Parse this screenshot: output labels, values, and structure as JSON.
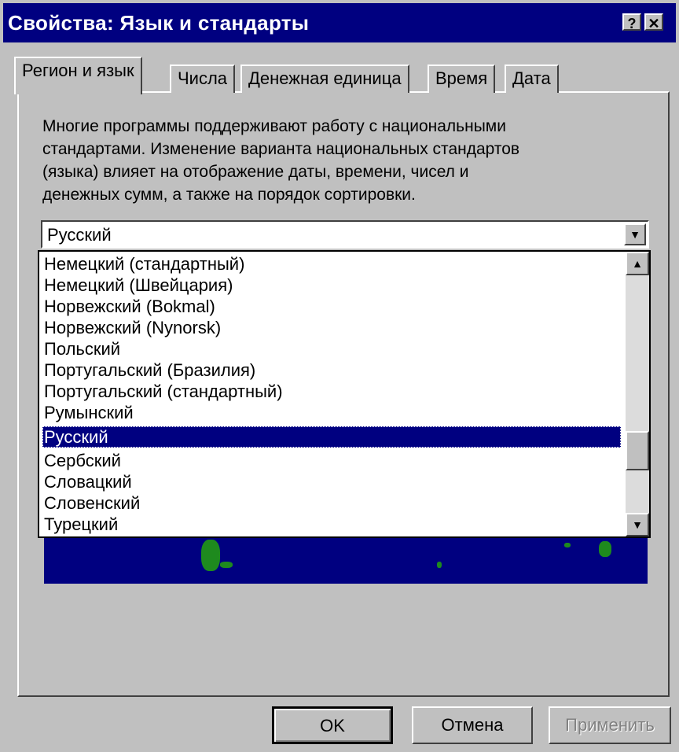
{
  "window": {
    "title": "Свойства: Язык и стандарты",
    "help_label": "?",
    "close_label": "✕"
  },
  "tabs": [
    {
      "label": "Регион и язык",
      "active": true
    },
    {
      "label": "Числа",
      "active": false
    },
    {
      "label": "Денежная единица",
      "active": false
    },
    {
      "label": "Время",
      "active": false
    },
    {
      "label": "Дата",
      "active": false
    }
  ],
  "description": [
    "Многие программы поддерживают работу с национальными",
    "стандартами. Изменение варианта национальных стандартов",
    "(языка) влияет на отображение даты, времени, чисел и",
    "денежных сумм, а также на порядок сортировки."
  ],
  "locale_select": {
    "value": "Русский",
    "options": [
      "Немецкий (стандартный)",
      "Немецкий (Швейцария)",
      "Норвежский (Bokmal)",
      "Норвежский (Nynorsk)",
      "Польский",
      "Португальский (Бразилия)",
      "Португальский (стандартный)",
      "Румынский",
      "Русский",
      "Сербский",
      "Словацкий",
      "Словенский",
      "Турецкий"
    ],
    "selected_index": 8
  },
  "buttons": {
    "ok": "OK",
    "cancel": "Отмена",
    "apply": "Применить"
  },
  "colors": {
    "titlebar": "#000080",
    "selection": "#000080",
    "face": "#c0c0c0",
    "map_land": "#1e8a1e"
  }
}
